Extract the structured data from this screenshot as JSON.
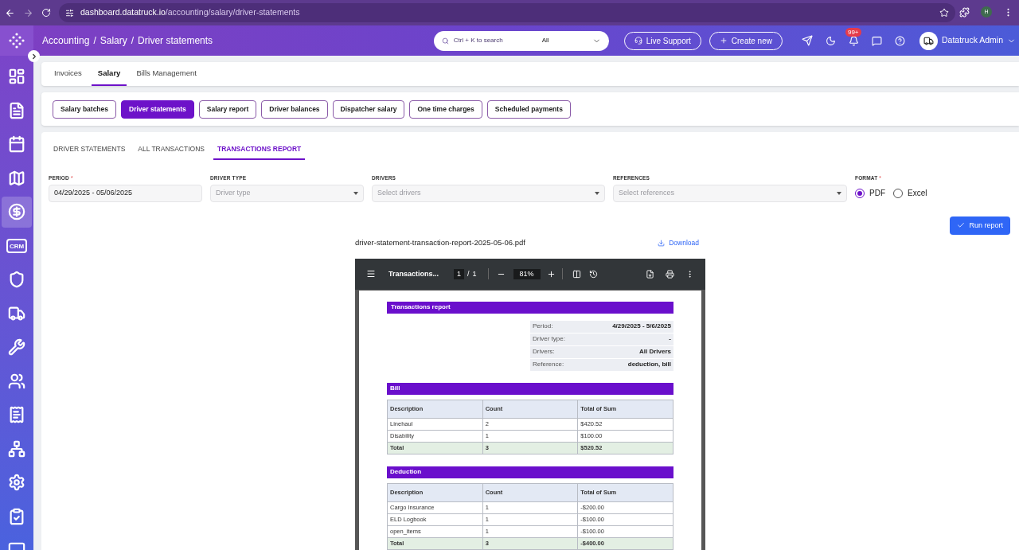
{
  "browser": {
    "url_host": "dashboard.datatruck.io",
    "url_path": "/accounting/salary/driver-statements",
    "profile": "H"
  },
  "header": {
    "breadcrumb": [
      "Accounting",
      "Salary",
      "Driver statements"
    ],
    "separator": "/",
    "search": {
      "placeholder": "Ctrl + K to search",
      "scope": "All"
    },
    "buttons": [
      {
        "kind": "support",
        "label": "Live Support"
      },
      {
        "kind": "create",
        "label": "Create new"
      }
    ],
    "notification_count": "99+",
    "user": "Datatruck Admin"
  },
  "sidebar": {
    "items": [
      {
        "selected": false
      },
      {
        "selected": false
      },
      {
        "selected": false
      },
      {
        "selected": false
      },
      {
        "selected": true
      },
      {
        "selected": false,
        "text": "CRM"
      },
      {
        "selected": false
      },
      {
        "selected": false
      },
      {
        "selected": false
      },
      {
        "selected": false
      },
      {
        "selected": false
      },
      {
        "selected": false
      },
      {
        "selected": false
      },
      {
        "selected": false
      },
      {
        "selected": false
      }
    ]
  },
  "top_tabs": [
    {
      "label": "Invoices",
      "selected": false
    },
    {
      "label": "Salary",
      "selected": true
    },
    {
      "label": "Bills Management",
      "selected": false
    }
  ],
  "section_buttons": [
    {
      "label": "Salary batches",
      "selected": false
    },
    {
      "label": "Driver statements",
      "selected": true
    },
    {
      "label": "Salary report",
      "selected": false
    },
    {
      "label": "Driver balances",
      "selected": false
    },
    {
      "label": "Dispatcher salary",
      "selected": false
    },
    {
      "label": "One time charges",
      "selected": false
    },
    {
      "label": "Scheduled payments",
      "selected": false
    }
  ],
  "sub_tabs": [
    {
      "label": "DRIVER STATEMENTS",
      "selected": false
    },
    {
      "label": "ALL TRANSACTIONS",
      "selected": false
    },
    {
      "label": "TRANSACTIONS REPORT",
      "selected": true
    }
  ],
  "filters": [
    {
      "kind": "date",
      "label": "PERIOD",
      "required_mark": "*",
      "value": "04/29/2025 - 05/06/2025"
    },
    {
      "kind": "select",
      "label": "DRIVER TYPE",
      "placeholder": "Driver type"
    },
    {
      "kind": "select",
      "label": "DRIVERS",
      "placeholder": "Select drivers"
    },
    {
      "kind": "select",
      "label": "REFERENCES",
      "placeholder": "Select references"
    },
    {
      "kind": "radio",
      "label": "FORMAT",
      "required_mark": "*",
      "options": [
        {
          "label": "PDF",
          "selected": true
        },
        {
          "label": "Excel",
          "selected": false
        }
      ]
    }
  ],
  "run_button": "Run report",
  "file": {
    "name": "driver-statement-transaction-report-2025-05-06.pdf",
    "download": "Download"
  },
  "pdf_viewer": {
    "title": "Transactions...",
    "page": "1",
    "page_separator": "/",
    "page_total": "1",
    "zoom": "81%",
    "document": {
      "title": "Transactions report",
      "summary": [
        {
          "label": "Period:",
          "value": "4/29/2025 - 5/6/2025"
        },
        {
          "label": "Driver type:",
          "value": "-"
        },
        {
          "label": "Drivers:",
          "value": "All Drivers"
        },
        {
          "label": "Reference:",
          "value": "deduction, bill"
        }
      ],
      "sections": [
        {
          "title": "Bill",
          "columns": [
            "Description",
            "Count",
            "Total of Sum"
          ],
          "rows": [
            [
              "Linehaul",
              "2",
              "$420.52"
            ],
            [
              "Disability",
              "1",
              "$100.00"
            ]
          ],
          "total": [
            "Total",
            "3",
            "$520.52"
          ]
        },
        {
          "title": "Deduction",
          "columns": [
            "Description",
            "Count",
            "Total of Sum"
          ],
          "rows": [
            [
              "Cargo Insurance",
              "1",
              "-$200.00"
            ],
            [
              "ELD Logbook",
              "1",
              "-$100.00"
            ],
            [
              "open_items",
              "1",
              "-$100.00"
            ]
          ],
          "total": [
            "Total",
            "3",
            "-$400.00"
          ]
        }
      ]
    }
  }
}
